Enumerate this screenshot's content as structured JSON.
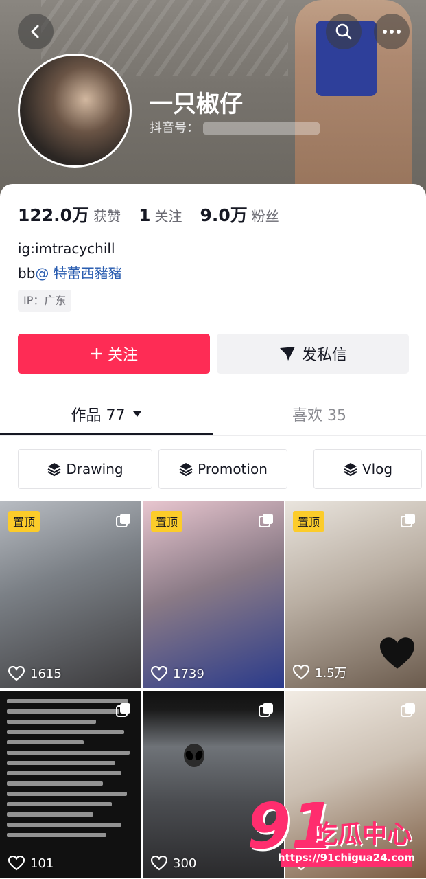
{
  "profile": {
    "nickname": "一只椒仔",
    "id_label": "抖音号："
  },
  "stats": [
    {
      "value": "122.0万",
      "label": "获赞"
    },
    {
      "value": "1",
      "label": "关注"
    },
    {
      "value": "9.0万",
      "label": "粉丝"
    }
  ],
  "bio": {
    "line1": "ig:imtracychill",
    "line2_prefix": "bb",
    "line2_mention": "@ 特蕾西豬豬"
  },
  "ip_tag": "IP：广东",
  "actions": {
    "follow_label": "关注",
    "message_label": "发私信"
  },
  "tabs": {
    "works_label": "作品 77",
    "likes_label": "喜欢 35"
  },
  "collections": [
    "Drawing",
    "Promotion",
    "Vlog"
  ],
  "videos": [
    {
      "pinned": "置顶",
      "likes": "1615"
    },
    {
      "pinned": "置顶",
      "likes": "1739"
    },
    {
      "pinned": "置顶",
      "likes": "1.5万"
    },
    {
      "likes": "101"
    },
    {
      "likes": "300"
    },
    {
      "likes": ""
    }
  ],
  "watermark": {
    "number": "91",
    "text": "吃瓜中心",
    "url": "https://91chigua24.com"
  }
}
